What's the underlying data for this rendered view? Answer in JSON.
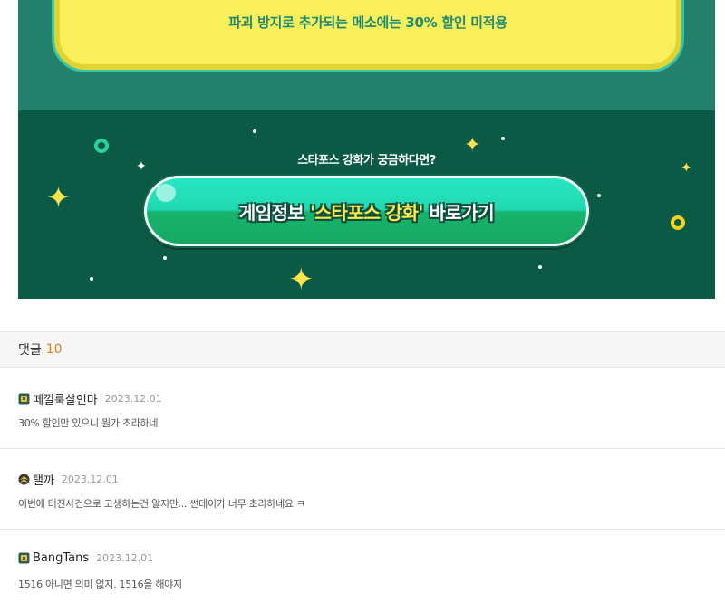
{
  "banner": {
    "notice": "파괴 방지로 추가되는 메소에는 30% 할인 미적용",
    "cta_question": "스타포스 강화가 궁금하다면?",
    "cta_prefix": "게임정보 ",
    "cta_highlight": "'스타포스 강화'",
    "cta_suffix": " 바로가기"
  },
  "comments": {
    "label": "댓글",
    "count": "10",
    "items": [
      {
        "name": "떼껄룩살인마",
        "date": "2023.12.01",
        "text": "30% 할인만 있으니 뭔가 초라하네",
        "icon": "guild-badge-icon"
      },
      {
        "name": "탤까",
        "date": "2023.12.01",
        "text": "이번에 터진사건으로 고생하는건 알지만... 썬데이가 너무 초라하네요 ㅋ",
        "icon": "rank-badge-icon"
      },
      {
        "name": "BangTans",
        "date": "2023.12.01",
        "text": "1516 아니면 의미 없지. 1516을 해야지",
        "icon": "guild-badge-icon"
      }
    ]
  },
  "colors": {
    "banner_top": "#23806a",
    "banner_bottom": "#0b5a45",
    "notice_box": "#f9ef5a",
    "accent_count": "#e57a1a"
  }
}
